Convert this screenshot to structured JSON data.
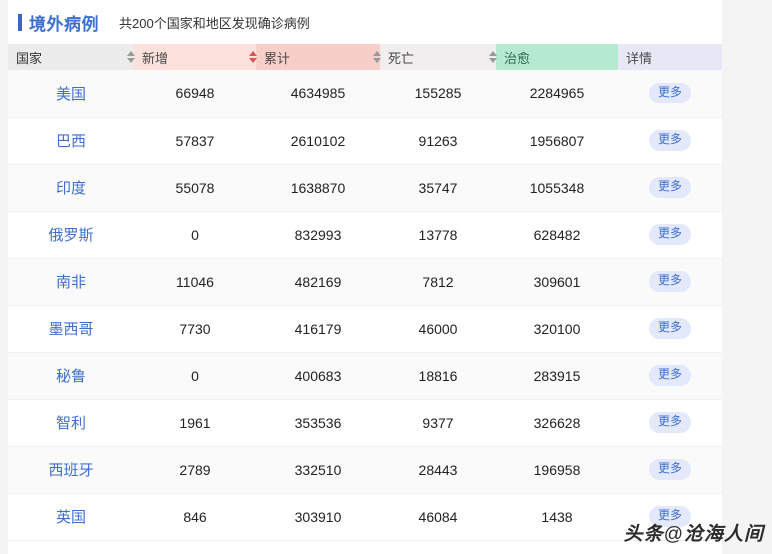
{
  "panel": {
    "title": "境外病例",
    "subtitle": "共200个国家和地区发现确诊病例",
    "accent_color": "#3c63c8",
    "title_color": "#3d6fd0"
  },
  "table": {
    "columns": [
      {
        "key": "country",
        "label": "国家",
        "bg": "#ececec",
        "sortable": false,
        "sort_state": "none"
      },
      {
        "key": "new",
        "label": "新增",
        "bg": "#fbe0db",
        "sortable": true,
        "sort_state": "none"
      },
      {
        "key": "total",
        "label": "累计",
        "bg": "#f8cfc8",
        "sortable": true,
        "sort_state": "desc"
      },
      {
        "key": "death",
        "label": "死亡",
        "bg": "#f0eeee",
        "sortable": true,
        "sort_state": "none"
      },
      {
        "key": "cured",
        "label": "治愈",
        "bg": "#b5e9d2",
        "sortable": true,
        "sort_state": "none"
      },
      {
        "key": "detail",
        "label": "详情",
        "bg": "#e7e7f6",
        "sortable": false,
        "sort_state": "none"
      }
    ],
    "detail_button_label": "更多",
    "rows": [
      {
        "country": "美国",
        "new": "66948",
        "total": "4634985",
        "death": "155285",
        "cured": "2284965"
      },
      {
        "country": "巴西",
        "new": "57837",
        "total": "2610102",
        "death": "91263",
        "cured": "1956807"
      },
      {
        "country": "印度",
        "new": "55078",
        "total": "1638870",
        "death": "35747",
        "cured": "1055348"
      },
      {
        "country": "俄罗斯",
        "new": "0",
        "total": "832993",
        "death": "13778",
        "cured": "628482"
      },
      {
        "country": "南非",
        "new": "11046",
        "total": "482169",
        "death": "7812",
        "cured": "309601"
      },
      {
        "country": "墨西哥",
        "new": "7730",
        "total": "416179",
        "death": "46000",
        "cured": "320100"
      },
      {
        "country": "秘鲁",
        "new": "0",
        "total": "400683",
        "death": "18816",
        "cured": "283915"
      },
      {
        "country": "智利",
        "new": "1961",
        "total": "353536",
        "death": "9377",
        "cured": "326628"
      },
      {
        "country": "西班牙",
        "new": "2789",
        "total": "332510",
        "death": "28443",
        "cured": "196958"
      },
      {
        "country": "英国",
        "new": "846",
        "total": "303910",
        "death": "46084",
        "cured": "1438"
      }
    ]
  },
  "watermark": {
    "prefix": "头条",
    "at": "@",
    "name": "沧海人间"
  }
}
